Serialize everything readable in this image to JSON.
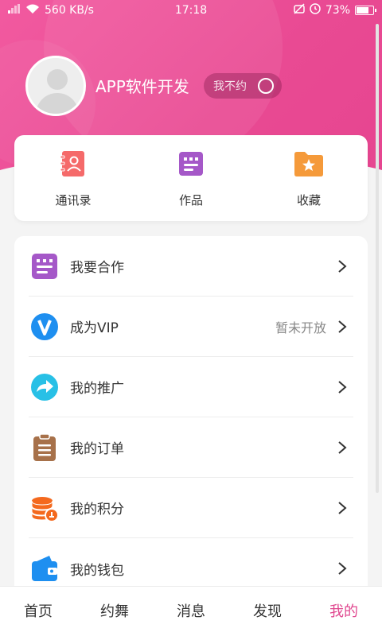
{
  "status_bar": {
    "network_speed": "560 KB/s",
    "time": "17:18",
    "battery": "73%"
  },
  "profile": {
    "name": "APP软件开发",
    "toggle_label": "我不约"
  },
  "quick_actions": [
    {
      "label": "通讯录",
      "icon": "contacts-icon",
      "color": "#f56a6a"
    },
    {
      "label": "作品",
      "icon": "works-icon",
      "color": "#a558c8"
    },
    {
      "label": "收藏",
      "icon": "favorites-folder-icon",
      "color": "#f59a3a"
    }
  ],
  "menu": {
    "items": [
      {
        "label": "我要合作",
        "icon": "cooperate-icon",
        "extra": ""
      },
      {
        "label": "成为VIP",
        "icon": "vip-icon",
        "extra": "暂未开放"
      },
      {
        "label": "我的推广",
        "icon": "promotion-share-icon",
        "extra": ""
      },
      {
        "label": "我的订单",
        "icon": "orders-clipboard-icon",
        "extra": ""
      },
      {
        "label": "我的积分",
        "icon": "points-coins-icon",
        "extra": ""
      },
      {
        "label": "我的钱包",
        "icon": "wallet-icon",
        "extra": ""
      }
    ]
  },
  "bottom_nav": {
    "tabs": [
      "首页",
      "约舞",
      "消息",
      "发现",
      "我的"
    ],
    "active": "我的"
  },
  "colors": {
    "brand_pink": "#e94a93",
    "active_tab": "#e0478f"
  }
}
